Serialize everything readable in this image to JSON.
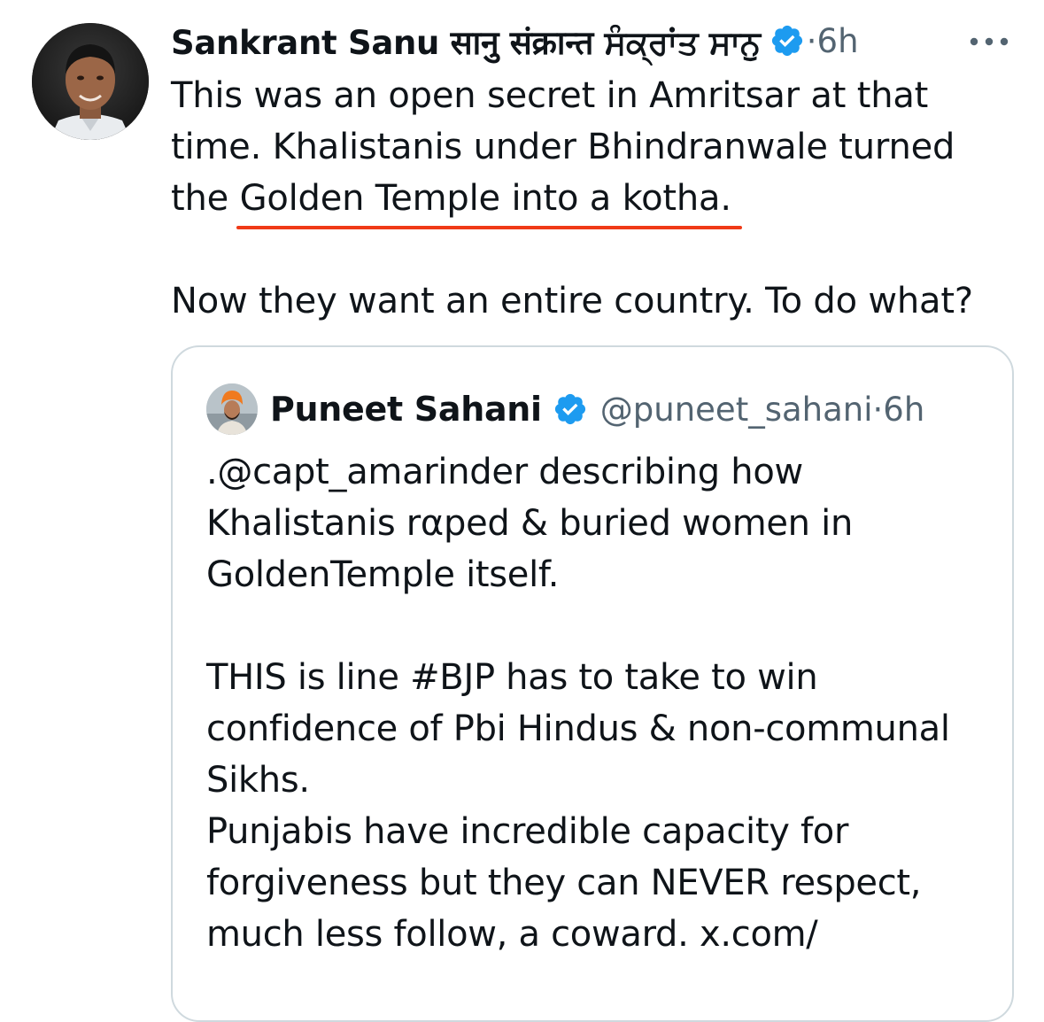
{
  "tweet": {
    "author_name": "Sankrant Sanu सानु संक्रान्त ਸੰਕ੍ਰਾਂਤ ਸਾਨੁ",
    "separator": "·",
    "time": "6h",
    "body": {
      "line1": "This was an open secret in Amritsar at that",
      "line2": "time. Khalistanis under Bhindranwale turned",
      "line3_prefix": "the ",
      "line3_underlined": "Golden Temple into a kotha.",
      "line4": "Now they want an entire country. To do what?"
    }
  },
  "quote": {
    "author_name": "Puneet Sahani",
    "handle": "@puneet_sahani",
    "separator": "·",
    "time": "6h",
    "lines": [
      ".@capt_amarinder describing how",
      "Khalistanis rαped & buried women in",
      "GoldenTemple itself.",
      "",
      "THIS is line #BJP has to take to win",
      "confidence of Pbi Hindus & non-communal",
      "Sikhs.",
      "Punjabis have incredible capacity for",
      "forgiveness but they can NEVER respect,",
      "much less follow, a coward. x.com/"
    ]
  },
  "colors": {
    "text": "#0f1419",
    "muted": "#536471",
    "verified": "#1d9bf0",
    "underline": "#f03a17",
    "card_border": "#cfd9de"
  },
  "icons": {
    "verified": "verified-badge-icon",
    "more": "more-options-icon"
  }
}
